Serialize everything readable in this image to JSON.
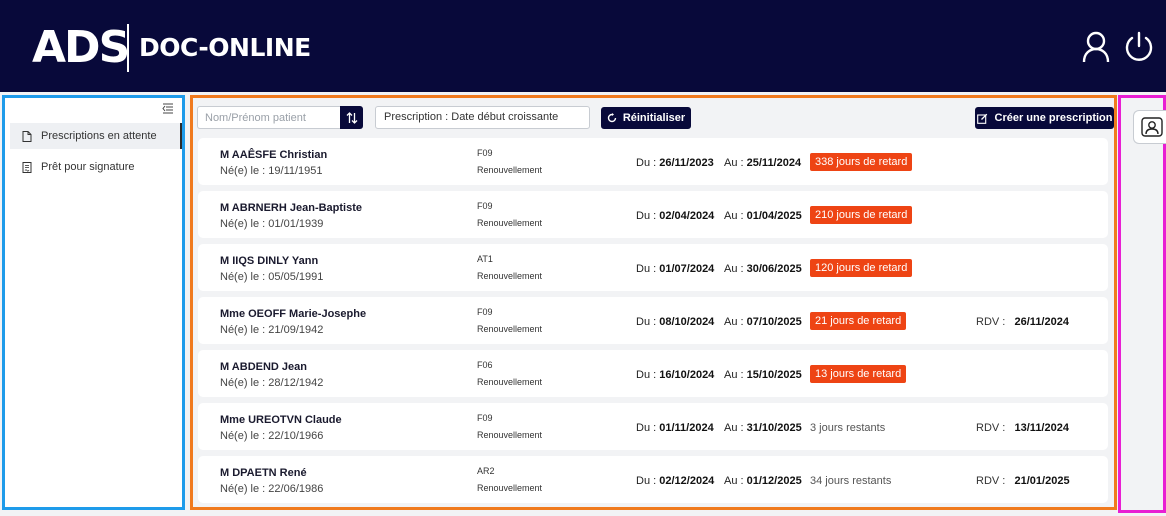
{
  "header": {
    "logo_text": "ADS",
    "app_title": "DOC-ONLINE",
    "user_icon": "user-icon",
    "power_icon": "power-icon"
  },
  "sidebar": {
    "collapse_icon": "menu-collapse-icon",
    "items": [
      {
        "label": "Prescriptions en attente",
        "icon": "document-icon",
        "active": true
      },
      {
        "label": "Prêt pour signature",
        "icon": "signature-document-icon",
        "active": false
      }
    ]
  },
  "toolbar": {
    "search_placeholder": "Nom/Prénom patient",
    "sort_icon": "sort-icon",
    "sort_select": "Prescription : Date début croissante",
    "reset_label": "Réinitialiser",
    "create_label": "Créer une prescription"
  },
  "prescriptions": [
    {
      "name": "M AAÊSFE Christian",
      "birth": "Né(e) le : 19/11/1951",
      "code": "F09",
      "kind": "Renouvellement",
      "du_label": "Du :",
      "du": "26/11/2023",
      "au_label": "Au :",
      "au": "25/11/2024",
      "status": "338 jours de retard",
      "status_type": "late",
      "rdv_label": "",
      "rdv": ""
    },
    {
      "name": "M ABRNERH Jean-Baptiste",
      "birth": "Né(e) le : 01/01/1939",
      "code": "F09",
      "kind": "Renouvellement",
      "du_label": "Du :",
      "du": "02/04/2024",
      "au_label": "Au :",
      "au": "01/04/2025",
      "status": "210 jours de retard",
      "status_type": "late",
      "rdv_label": "",
      "rdv": ""
    },
    {
      "name": "M IIQS DINLY Yann",
      "birth": "Né(e) le : 05/05/1991",
      "code": "AT1",
      "kind": "Renouvellement",
      "du_label": "Du :",
      "du": "01/07/2024",
      "au_label": "Au :",
      "au": "30/06/2025",
      "status": "120 jours de retard",
      "status_type": "late",
      "rdv_label": "",
      "rdv": ""
    },
    {
      "name": "Mme OEOFF Marie-Josephe",
      "birth": "Né(e) le : 21/09/1942",
      "code": "F09",
      "kind": "Renouvellement",
      "du_label": "Du :",
      "du": "08/10/2024",
      "au_label": "Au :",
      "au": "07/10/2025",
      "status": "21 jours de retard",
      "status_type": "late",
      "rdv_label": "RDV :",
      "rdv": "26/11/2024"
    },
    {
      "name": "M ABDEND Jean",
      "birth": "Né(e) le : 28/12/1942",
      "code": "F06",
      "kind": "Renouvellement",
      "du_label": "Du :",
      "du": "16/10/2024",
      "au_label": "Au :",
      "au": "15/10/2025",
      "status": "13 jours de retard",
      "status_type": "late",
      "rdv_label": "",
      "rdv": ""
    },
    {
      "name": "Mme UREOTVN Claude",
      "birth": "Né(e) le : 22/10/1966",
      "code": "F09",
      "kind": "Renouvellement",
      "du_label": "Du :",
      "du": "01/11/2024",
      "au_label": "Au :",
      "au": "31/10/2025",
      "status": "3 jours restants",
      "status_type": "remaining",
      "rdv_label": "RDV :",
      "rdv": "13/11/2024"
    },
    {
      "name": "M DPAETN René",
      "birth": "Né(e) le : 22/06/1986",
      "code": "AR2",
      "kind": "Renouvellement",
      "du_label": "Du :",
      "du": "02/12/2024",
      "au_label": "Au :",
      "au": "01/12/2025",
      "status": "34 jours restants",
      "status_type": "remaining",
      "rdv_label": "RDV :",
      "rdv": "21/01/2025"
    }
  ],
  "right_panel": {
    "contact_icon": "contact-card-icon"
  },
  "colors": {
    "header_bg": "#08093a",
    "late_badge": "#ee4414",
    "sidebar_outline": "#1e9bea",
    "main_outline": "#f07a1e",
    "right_outline": "#e81ed3"
  }
}
